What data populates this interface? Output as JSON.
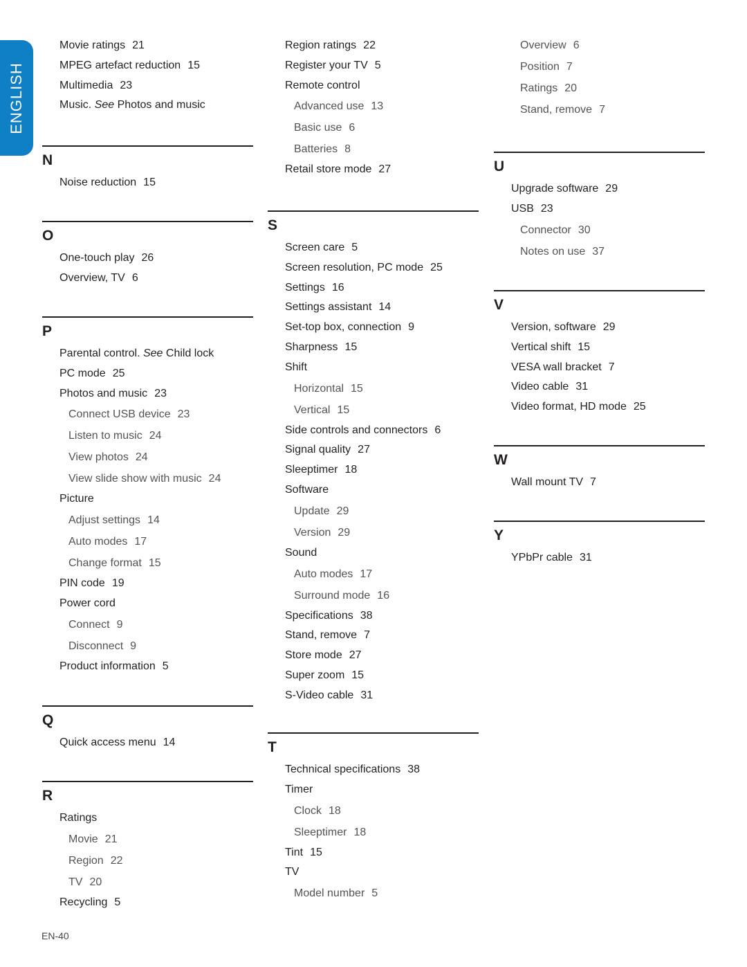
{
  "language_tab": {
    "label": "ENGLISH",
    "color": "#0f7fc6"
  },
  "page_number": "EN-40",
  "columns": [
    {
      "sections": [
        {
          "letter": "",
          "entries": [
            {
              "level": "main",
              "text": "Movie ratings",
              "page": "21"
            },
            {
              "level": "main",
              "text": "MPEG artefact reduction",
              "page": "15"
            },
            {
              "level": "main",
              "text": "Multimedia",
              "page": "23"
            },
            {
              "level": "main",
              "text": "Music.",
              "see": "See",
              "see_target": "Photos and music",
              "page": ""
            }
          ]
        },
        {
          "letter": "N",
          "entries": [
            {
              "level": "main",
              "text": "Noise reduction",
              "page": "15"
            }
          ]
        },
        {
          "letter": "O",
          "entries": [
            {
              "level": "main",
              "text": "One-touch play",
              "page": "26"
            },
            {
              "level": "main",
              "text": "Overview, TV",
              "page": "6"
            }
          ]
        },
        {
          "letter": "P",
          "entries": [
            {
              "level": "main",
              "text": "Parental control.",
              "see": "See",
              "see_target": "Child lock",
              "page": ""
            },
            {
              "level": "main",
              "text": "PC mode",
              "page": "25"
            },
            {
              "level": "main",
              "text": "Photos and music",
              "page": "23"
            },
            {
              "level": "sub",
              "text": "Connect USB device",
              "page": "23"
            },
            {
              "level": "sub",
              "text": "Listen to music",
              "page": "24"
            },
            {
              "level": "sub",
              "text": "View photos",
              "page": "24"
            },
            {
              "level": "sub",
              "text": "View slide show with music",
              "page": "24"
            },
            {
              "level": "main",
              "text": "Picture",
              "page": ""
            },
            {
              "level": "sub",
              "text": "Adjust settings",
              "page": "14"
            },
            {
              "level": "sub",
              "text": "Auto modes",
              "page": "17"
            },
            {
              "level": "sub",
              "text": "Change format",
              "page": "15"
            },
            {
              "level": "main",
              "text": "PIN code",
              "page": "19"
            },
            {
              "level": "main",
              "text": "Power cord",
              "page": ""
            },
            {
              "level": "sub",
              "text": "Connect",
              "page": "9"
            },
            {
              "level": "sub",
              "text": "Disconnect",
              "page": "9"
            },
            {
              "level": "main",
              "text": "Product information",
              "page": "5"
            }
          ]
        },
        {
          "letter": "Q",
          "entries": [
            {
              "level": "main",
              "text": "Quick access menu",
              "page": "14"
            }
          ]
        },
        {
          "letter": "R",
          "entries": [
            {
              "level": "main",
              "text": "Ratings",
              "page": ""
            },
            {
              "level": "sub",
              "text": "Movie",
              "page": "21"
            },
            {
              "level": "sub",
              "text": "Region",
              "page": "22"
            },
            {
              "level": "sub",
              "text": "TV",
              "page": "20"
            },
            {
              "level": "main",
              "text": "Recycling",
              "page": "5"
            }
          ]
        }
      ]
    },
    {
      "sections": [
        {
          "letter": "",
          "entries": [
            {
              "level": "main",
              "text": "Region ratings",
              "page": "22"
            },
            {
              "level": "main",
              "text": "Register your TV",
              "page": "5"
            },
            {
              "level": "main",
              "text": "Remote control",
              "page": ""
            },
            {
              "level": "sub",
              "text": "Advanced use",
              "page": "13"
            },
            {
              "level": "sub",
              "text": "Basic use",
              "page": "6"
            },
            {
              "level": "sub",
              "text": "Batteries",
              "page": "8"
            },
            {
              "level": "main",
              "text": "Retail store mode",
              "page": "27"
            }
          ]
        },
        {
          "letter": "S",
          "entries": [
            {
              "level": "main",
              "text": "Screen care",
              "page": "5"
            },
            {
              "level": "main",
              "text": "Screen resolution, PC mode",
              "page": "25"
            },
            {
              "level": "main",
              "text": "Settings",
              "page": "16"
            },
            {
              "level": "main",
              "text": "Settings assistant",
              "page": "14"
            },
            {
              "level": "main",
              "text": "Set-top box, connection",
              "page": "9"
            },
            {
              "level": "main",
              "text": "Sharpness",
              "page": "15"
            },
            {
              "level": "main",
              "text": "Shift",
              "page": ""
            },
            {
              "level": "sub",
              "text": "Horizontal",
              "page": "15"
            },
            {
              "level": "sub",
              "text": "Vertical",
              "page": "15"
            },
            {
              "level": "main",
              "text": "Side controls and connectors",
              "page": "6"
            },
            {
              "level": "main",
              "text": "Signal quality",
              "page": "27"
            },
            {
              "level": "main",
              "text": "Sleeptimer",
              "page": "18"
            },
            {
              "level": "main",
              "text": "Software",
              "page": ""
            },
            {
              "level": "sub",
              "text": "Update",
              "page": "29"
            },
            {
              "level": "sub",
              "text": "Version",
              "page": "29"
            },
            {
              "level": "main",
              "text": "Sound",
              "page": ""
            },
            {
              "level": "sub",
              "text": "Auto modes",
              "page": "17"
            },
            {
              "level": "sub",
              "text": "Surround mode",
              "page": "16"
            },
            {
              "level": "main",
              "text": "Specifications",
              "page": "38"
            },
            {
              "level": "main",
              "text": "Stand, remove",
              "page": "7"
            },
            {
              "level": "main",
              "text": "Store mode",
              "page": "27"
            },
            {
              "level": "main",
              "text": "Super zoom",
              "page": "15"
            },
            {
              "level": "main",
              "text": "S-Video cable",
              "page": "31"
            }
          ]
        },
        {
          "letter": "T",
          "entries": [
            {
              "level": "main",
              "text": "Technical specifications",
              "page": "38"
            },
            {
              "level": "main",
              "text": "Timer",
              "page": ""
            },
            {
              "level": "sub",
              "text": "Clock",
              "page": "18"
            },
            {
              "level": "sub",
              "text": "Sleeptimer",
              "page": "18"
            },
            {
              "level": "main",
              "text": "Tint",
              "page": "15"
            },
            {
              "level": "main",
              "text": "TV",
              "page": ""
            },
            {
              "level": "sub",
              "text": "Model number",
              "page": "5"
            }
          ]
        }
      ]
    },
    {
      "sections": [
        {
          "letter": "",
          "entries": [
            {
              "level": "sub",
              "text": "Overview",
              "page": "6"
            },
            {
              "level": "sub",
              "text": "Position",
              "page": "7"
            },
            {
              "level": "sub",
              "text": "Ratings",
              "page": "20"
            },
            {
              "level": "sub",
              "text": "Stand, remove",
              "page": "7"
            }
          ]
        },
        {
          "letter": "U",
          "entries": [
            {
              "level": "main",
              "text": "Upgrade software",
              "page": "29"
            },
            {
              "level": "main",
              "text": "USB",
              "page": "23"
            },
            {
              "level": "sub",
              "text": "Connector",
              "page": "30"
            },
            {
              "level": "sub",
              "text": "Notes on use",
              "page": "37"
            }
          ]
        },
        {
          "letter": "V",
          "entries": [
            {
              "level": "main",
              "text": "Version, software",
              "page": "29"
            },
            {
              "level": "main",
              "text": "Vertical shift",
              "page": "15"
            },
            {
              "level": "main",
              "text": "VESA wall bracket",
              "page": "7"
            },
            {
              "level": "main",
              "text": "Video cable",
              "page": "31"
            },
            {
              "level": "main",
              "text": "Video format, HD mode",
              "page": "25"
            }
          ]
        },
        {
          "letter": "W",
          "entries": [
            {
              "level": "main",
              "text": "Wall mount TV",
              "page": "7"
            }
          ]
        },
        {
          "letter": "Y",
          "entries": [
            {
              "level": "main",
              "text": "YPbPr cable",
              "page": "31"
            }
          ]
        }
      ]
    }
  ]
}
